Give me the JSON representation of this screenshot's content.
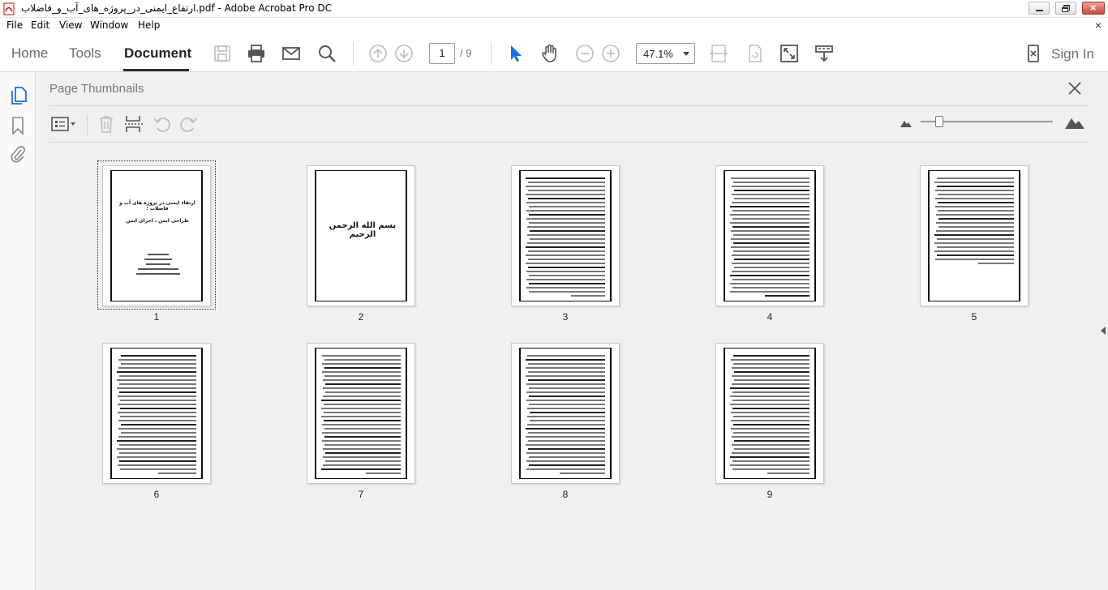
{
  "window": {
    "title": "ارتفاع_ایمنی_در_پروژه_های_آب_و_فاضلاب.pdf - Adobe Acrobat Pro DC"
  },
  "menu": {
    "items": [
      "File",
      "Edit",
      "View",
      "Window",
      "Help"
    ],
    "close": "×"
  },
  "toolbar": {
    "tabs": [
      "Home",
      "Tools",
      "Document"
    ],
    "active_tab": "Document",
    "current_page": "1",
    "total_pages": "/ 9",
    "zoom": "47.1%",
    "sign_in": "Sign In"
  },
  "panel": {
    "title": "Page Thumbnails"
  },
  "thumbnails": {
    "labels": [
      "1",
      "2",
      "3",
      "4",
      "5",
      "6",
      "7",
      "8",
      "9"
    ],
    "selected": "1",
    "cover_title": "ارتقاء ایمنی در پروژه های آب و فاضلاب :",
    "cover_subtitle": "طراحی ایمن ، اجرای ایمن",
    "page2_text": "بسم الله الرحمن الرحیم"
  },
  "colors": {
    "accent_cursor": "#1e6fd9",
    "toolbar_bg": "#ffffff",
    "panel_bg": "#f0f0f0"
  }
}
